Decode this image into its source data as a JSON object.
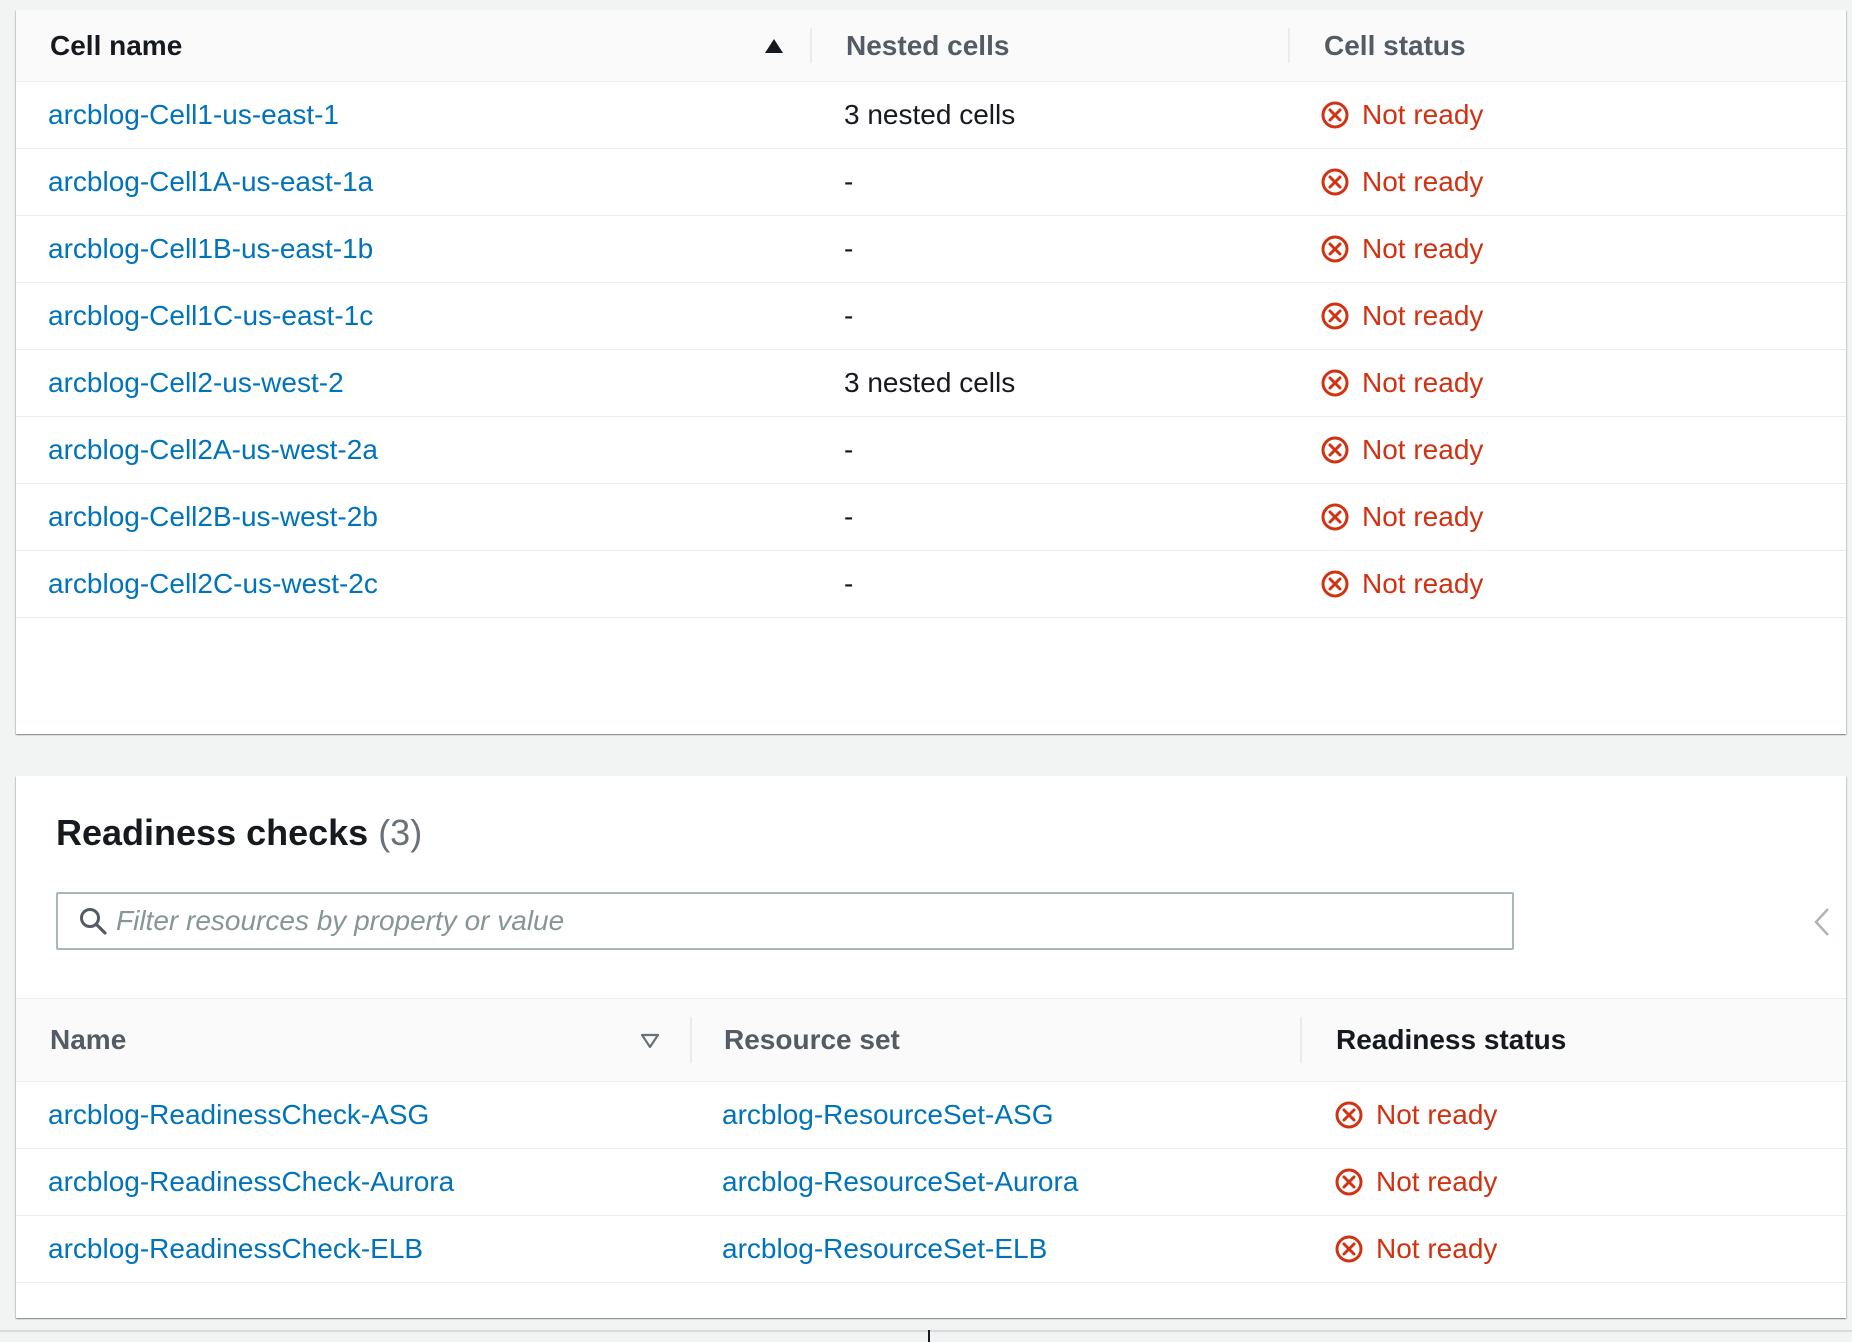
{
  "cells_table": {
    "columns": {
      "name": "Cell name",
      "nested": "Nested cells",
      "status": "Cell status"
    },
    "rows": [
      {
        "name": "arcblog-Cell1-us-east-1",
        "nested": "3 nested cells",
        "status": "Not ready"
      },
      {
        "name": "arcblog-Cell1A-us-east-1a",
        "nested": "-",
        "status": "Not ready"
      },
      {
        "name": "arcblog-Cell1B-us-east-1b",
        "nested": "-",
        "status": "Not ready"
      },
      {
        "name": "arcblog-Cell1C-us-east-1c",
        "nested": "-",
        "status": "Not ready"
      },
      {
        "name": "arcblog-Cell2-us-west-2",
        "nested": "3 nested cells",
        "status": "Not ready"
      },
      {
        "name": "arcblog-Cell2A-us-west-2a",
        "nested": "-",
        "status": "Not ready"
      },
      {
        "name": "arcblog-Cell2B-us-west-2b",
        "nested": "-",
        "status": "Not ready"
      },
      {
        "name": "arcblog-Cell2C-us-west-2c",
        "nested": "-",
        "status": "Not ready"
      }
    ]
  },
  "readiness_checks": {
    "title": "Readiness checks",
    "count": "(3)",
    "filter_placeholder": "Filter resources by property or value",
    "columns": {
      "name": "Name",
      "resource_set": "Resource set",
      "status": "Readiness status"
    },
    "rows": [
      {
        "name": "arcblog-ReadinessCheck-ASG",
        "resource_set": "arcblog-ResourceSet-ASG",
        "status": "Not ready"
      },
      {
        "name": "arcblog-ReadinessCheck-Aurora",
        "resource_set": "arcblog-ResourceSet-Aurora",
        "status": "Not ready"
      },
      {
        "name": "arcblog-ReadinessCheck-ELB",
        "resource_set": "arcblog-ResourceSet-ELB",
        "status": "Not ready"
      }
    ]
  },
  "icons": {
    "status": "x-circle-icon",
    "sort_ascending": "caret-up-icon",
    "sort_inactive": "caret-down-outline-icon",
    "search": "search-icon",
    "collapse": "chevron-left-icon"
  },
  "colors": {
    "link": "#0073bb",
    "error": "#d13212",
    "header_text": "#545b64",
    "background": "#f2f3f3"
  }
}
